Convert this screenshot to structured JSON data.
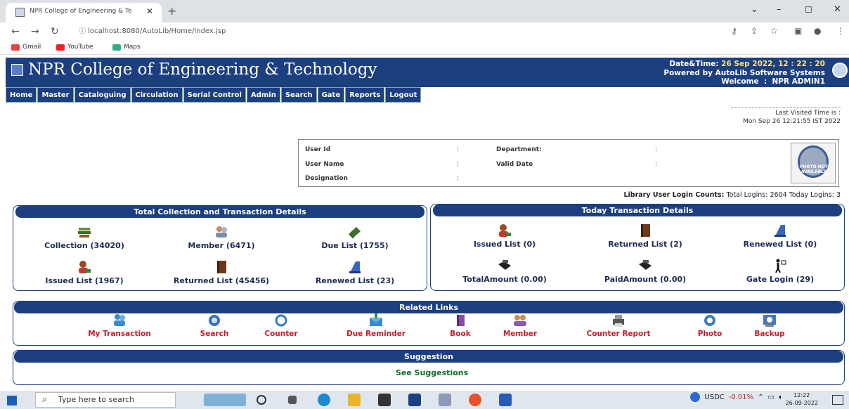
{
  "browser": {
    "tab_title": "NPR College of Engineering & Te",
    "url": "localhost:8080/AutoLib/Home/index.jsp",
    "bookmarks": [
      "Gmail",
      "YouTube",
      "Maps"
    ]
  },
  "header": {
    "college": "NPR College of Engineering & Technology",
    "datetime_label": "Date&Time:",
    "datetime_value": "26 Sep 2022, 12 : 22 : 20",
    "powered": "Powered by AutoLib Software Systems",
    "welcome_label": "Welcome",
    "welcome_value": "NPR ADMIN1"
  },
  "menu": [
    "Home",
    "Master",
    "Cataloguing",
    "Circulation",
    "Serial Control",
    "Admin",
    "Search",
    "Gate",
    "Reports",
    "Logout"
  ],
  "last_visited": {
    "label": "Last Visited Time is :",
    "value": "Mon Sep 26 12:21:55 IST 2022"
  },
  "user": {
    "user_id": "User Id",
    "user_name": "User Name",
    "designation": "Designation",
    "department": "Department:",
    "valid_date": "Valid Date",
    "colon": ":",
    "photo_text": "PHOTO NOT AVAILABLE"
  },
  "login_counts": {
    "label": "Library User Login Counts:",
    "total": "Total Logins: 2604",
    "today": "Today Logins: 3"
  },
  "total_panel": {
    "title": "Total Collection and Transaction Details",
    "items": [
      "Collection (34020)",
      "Member (6471)",
      "Due List (1755)",
      "Issued List (1967)",
      "Returned List (45456)",
      "Renewed List (23)"
    ]
  },
  "today_panel": {
    "title": "Today Transaction Details",
    "items": [
      "Issued List (0)",
      "Returned List (2)",
      "Renewed List (0)",
      "TotalAmount (0.00)",
      "PaidAmount (0.00)",
      "Gate Login (29)"
    ]
  },
  "related": {
    "title": "Related Links",
    "links": [
      "My Transaction",
      "Search",
      "Counter",
      "Due Reminder",
      "Book",
      "Member",
      "Counter Report",
      "Photo",
      "Backup"
    ]
  },
  "suggestion": {
    "title": "Suggestion",
    "link": "See Suggestions"
  },
  "taskbar": {
    "search_placeholder": "Type here to search",
    "ticker": "USDC",
    "change": "-0.01%",
    "time": "12:22",
    "date": "26-09-2022"
  },
  "colors": {
    "navy": "#1b3f7f",
    "link_red": "#c41e2a",
    "green": "#0a6e1e"
  }
}
